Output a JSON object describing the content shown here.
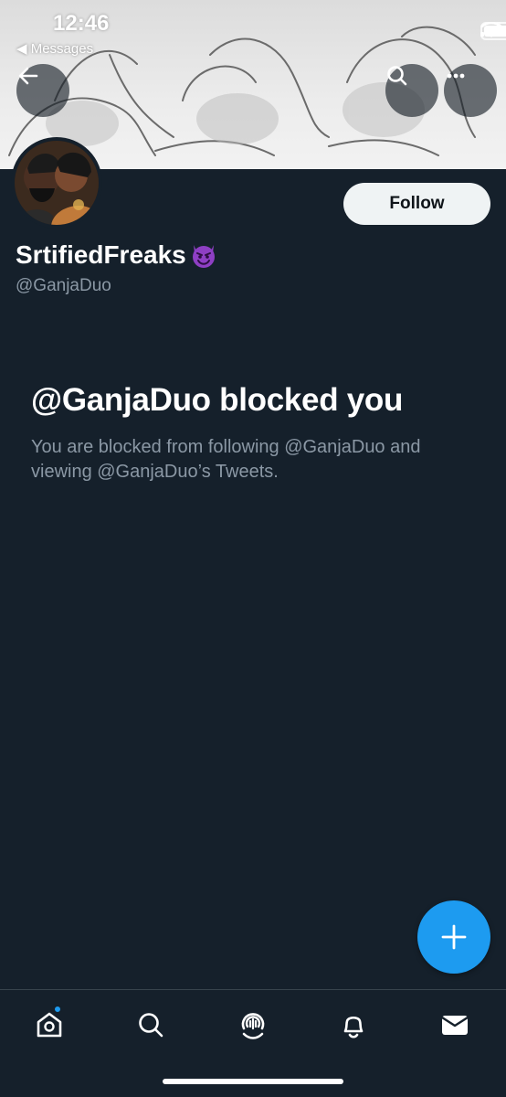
{
  "status_bar": {
    "time": "12:46",
    "back_to_app": "◀ Messages"
  },
  "profile": {
    "display_name": "SrtifiedFreaks",
    "name_emoji": "😈",
    "handle": "@GanjaDuo",
    "follow_label": "Follow"
  },
  "blocked": {
    "title": "@GanjaDuo blocked you",
    "description": "You are blocked from following @GanjaDuo and viewing @GanjaDuo’s Tweets."
  },
  "icons": {
    "back": "arrow-left-icon",
    "search": "search-icon",
    "more": "more-horizontal-icon",
    "compose": "plus-icon",
    "nav": [
      "home-icon",
      "search-icon",
      "spaces-icon",
      "bell-icon",
      "mail-icon"
    ]
  },
  "colors": {
    "background": "#15202b",
    "accent": "#1d9bf0",
    "secondary_text": "#8b98a5",
    "follow_bg": "#eff3f4"
  }
}
